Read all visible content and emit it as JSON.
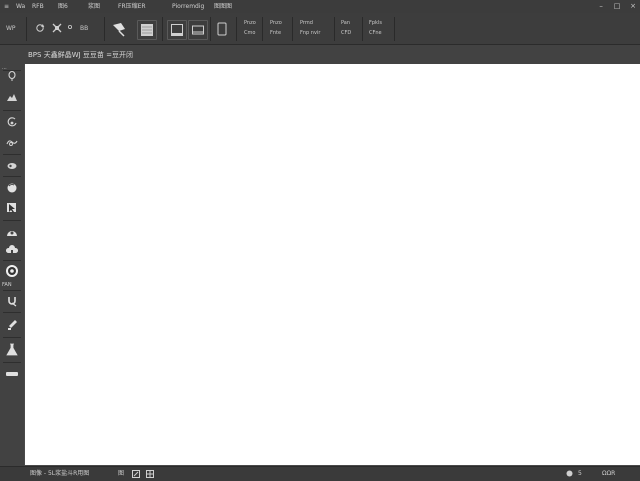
{
  "menu": {
    "items": [
      {
        "label": "≡",
        "icon": "app-menu-icon"
      },
      {
        "label": "Wa"
      },
      {
        "label": "RFB"
      },
      {
        "label": "图6"
      },
      {
        "label": "浆图"
      },
      {
        "label": "FR压缩ER"
      },
      {
        "label": "Piorremdig"
      },
      {
        "label": "图图图"
      }
    ],
    "window_controls": {
      "minimize": "–",
      "maximize": "□",
      "close": "×"
    }
  },
  "options": {
    "mode_label": "WP",
    "mode2_label": "BB",
    "group1": {
      "line1": "Pnzo",
      "line2": "Cmo"
    },
    "group2": {
      "line1": "Pnzo",
      "line2": "Fnte"
    },
    "group3": {
      "line1": "Prmd",
      "line2": "Fnp nvir"
    },
    "group4": {
      "line1": "Pan",
      "line2": "CFD"
    },
    "group5": {
      "line1": "Fpkls",
      "line2": "CFne"
    }
  },
  "document": {
    "tab_label": "BPS 天鑫鲜晶WJ  豆豆苗 =豆开闭"
  },
  "toolbar": {
    "top_label": "...",
    "tools": [
      "lasso-icon",
      "mountain-icon",
      "swirl-icon",
      "wave-icon",
      "ellipse-icon",
      "sphere-icon",
      "cursor-icon",
      "dome-icon",
      "cloud-icon",
      "target-icon",
      "magnet-icon",
      "brush-icon",
      "flask-icon",
      "eraser-icon"
    ],
    "mid_label": "FAN"
  },
  "status": {
    "left_text": "图像 - 5L浆盐斗R用图",
    "zoom_text": "图",
    "right_text": "5",
    "page_indicator": "ΩΩR"
  }
}
